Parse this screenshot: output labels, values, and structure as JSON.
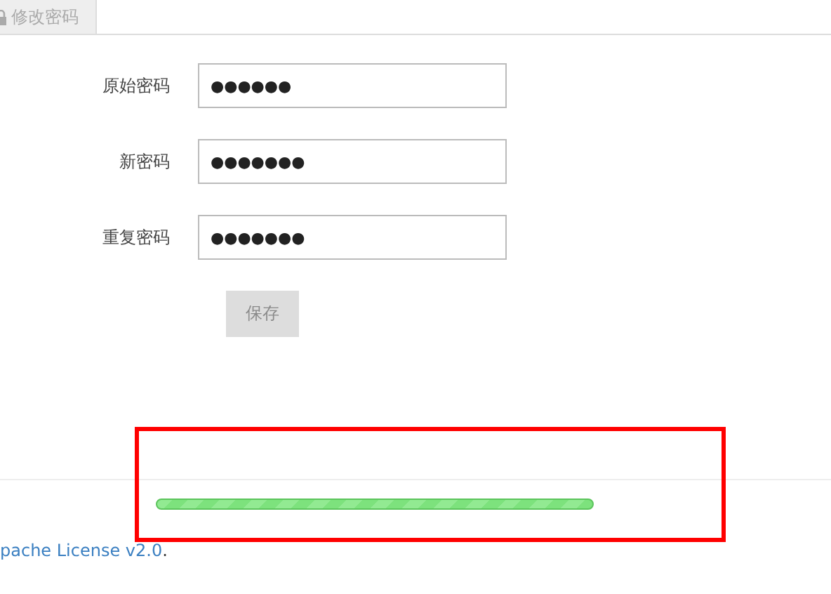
{
  "tabs": [
    {
      "label": "修改密码",
      "selected": true
    }
  ],
  "form": {
    "fields": [
      {
        "label": "原始密码",
        "value": "●●●●●●"
      },
      {
        "label": "新密码",
        "value": "●●●●●●●"
      },
      {
        "label": "重复密码",
        "value": "●●●●●●●"
      }
    ],
    "save_button": {
      "label": "保存",
      "disabled": true
    }
  },
  "footer": {
    "link": "pache License v2.0",
    "suffix": "."
  }
}
